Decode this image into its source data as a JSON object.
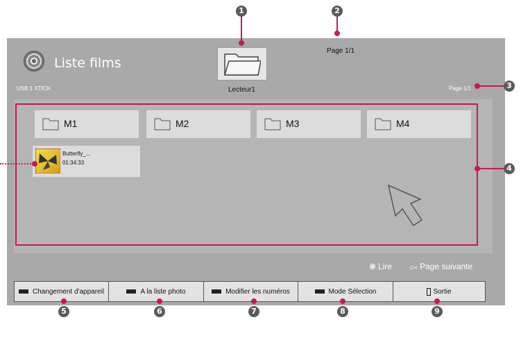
{
  "header": {
    "title": "Liste films",
    "device": "USB 1 XTICK",
    "drive": "Lecteur1"
  },
  "page": {
    "top": "Page 1/1",
    "right": "Page 1/1"
  },
  "folders": [
    "M1",
    "M2",
    "M3",
    "M4"
  ],
  "video": {
    "name": "Butterfly_...",
    "duration": "01:34:33"
  },
  "legend": {
    "play": "Lire",
    "ch": "CH",
    "next_page": "Page suivante"
  },
  "buttons": [
    {
      "label": "Changement d'appareil",
      "color": "#222222"
    },
    {
      "label": "A la liste photo",
      "color": "#222222"
    },
    {
      "label": "Modifier les numéros",
      "color": "#222222"
    },
    {
      "label": "Mode Sélection",
      "color": "#222222"
    },
    {
      "label": "Sortie",
      "icon": "exit-icon"
    }
  ],
  "callouts": [
    "1",
    "2",
    "3",
    "4",
    "5",
    "6",
    "7",
    "8",
    "9"
  ],
  "colors": {
    "accent": "#c8185a",
    "screen": "#a9a9a9",
    "callout": "#5b5b5b"
  }
}
